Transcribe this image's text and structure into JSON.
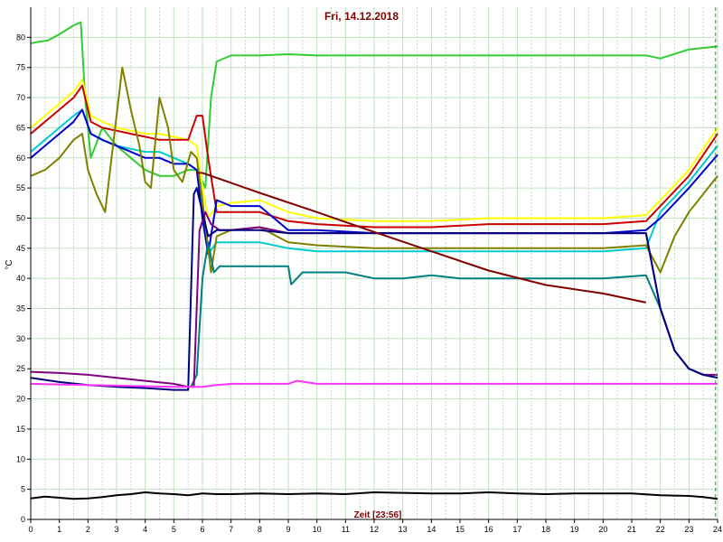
{
  "chart_data": {
    "type": "line",
    "title": "Fri, 14.12.2018",
    "xlabel": "Zeit [23:56]",
    "ylabel": "°C",
    "xlim": [
      0,
      24
    ],
    "ylim": [
      0,
      85
    ],
    "xticks": [
      0,
      1,
      2,
      3,
      4,
      5,
      6,
      7,
      8,
      9,
      10,
      11,
      12,
      13,
      14,
      15,
      16,
      17,
      18,
      19,
      20,
      21,
      22,
      23,
      24
    ],
    "yticks": [
      0,
      5,
      10,
      15,
      20,
      25,
      30,
      35,
      40,
      45,
      50,
      55,
      60,
      65,
      70,
      75,
      80
    ],
    "grid": true,
    "legend": "none",
    "background": "#ffffff",
    "grid_color": "#c0e0c0",
    "current_time_marker": 23.93,
    "series": [
      {
        "color": "#33cc33",
        "x": [
          0,
          0.2,
          0.6,
          1.0,
          1.5,
          1.75,
          1.9,
          2.1,
          2.5,
          3.0,
          3.5,
          4.0,
          4.5,
          5.0,
          5.5,
          5.8,
          6.1,
          6.3,
          6.5,
          7,
          8,
          9,
          10,
          12,
          14,
          16,
          18,
          20,
          21.5,
          22,
          23,
          24
        ],
        "y": [
          79,
          79.2,
          79.5,
          80.5,
          82,
          82.5,
          70,
          60,
          65,
          62,
          60,
          58,
          57,
          57,
          58,
          58,
          55,
          70,
          76,
          77,
          77,
          77.2,
          77,
          77,
          77,
          77,
          77,
          77,
          77,
          76.5,
          78,
          78.5
        ]
      },
      {
        "color": "#ffff00",
        "x": [
          0,
          0.5,
          1.0,
          1.5,
          1.8,
          2.1,
          2.5,
          3.0,
          3.5,
          4.0,
          4.5,
          5.0,
          5.5,
          5.8,
          6.0,
          6.2,
          6.5,
          7,
          8,
          9,
          10,
          12,
          14,
          16,
          18,
          20,
          21.5,
          22,
          23,
          24
        ],
        "y": [
          65,
          67,
          69,
          71,
          73,
          67,
          66,
          65,
          64.5,
          64,
          64,
          63.5,
          63,
          62,
          55,
          50,
          52,
          52.5,
          53,
          51,
          50,
          49.5,
          49.5,
          50,
          50,
          50,
          50.5,
          53,
          58,
          65
        ]
      },
      {
        "color": "#cc0000",
        "x": [
          0,
          0.5,
          1.0,
          1.5,
          1.8,
          2.1,
          2.5,
          3.0,
          3.5,
          4.0,
          4.5,
          5.0,
          5.5,
          5.8,
          6.0,
          6.2,
          6.5,
          7,
          8,
          9,
          10,
          12,
          14,
          16,
          18,
          20,
          21.5,
          22,
          23,
          24
        ],
        "y": [
          64,
          66,
          68,
          70,
          72,
          66,
          65,
          64.5,
          64,
          63.5,
          63,
          63,
          63,
          67,
          67,
          60,
          51,
          51,
          51,
          49.5,
          49,
          48.5,
          48.5,
          49,
          49,
          49,
          49.5,
          52,
          57,
          64
        ]
      },
      {
        "color": "#00cccc",
        "x": [
          0,
          0.5,
          1.0,
          1.5,
          1.8,
          2.1,
          2.5,
          3.0,
          3.5,
          4.0,
          4.5,
          5.0,
          5.5,
          5.8,
          6.0,
          6.2,
          6.5,
          7,
          8,
          9,
          10,
          12,
          14,
          16,
          18,
          20,
          21.5,
          22,
          23,
          24
        ],
        "y": [
          61,
          63,
          65,
          67,
          68,
          64,
          63,
          62,
          61.5,
          61,
          61,
          60,
          59,
          58,
          52,
          44,
          46,
          46,
          46,
          45,
          44.5,
          44.5,
          44.5,
          44.5,
          44.5,
          44.5,
          45,
          51,
          56,
          62
        ]
      },
      {
        "color": "#0000cc",
        "x": [
          0,
          0.5,
          1.0,
          1.5,
          1.8,
          2.1,
          2.5,
          3.0,
          3.5,
          4.0,
          4.5,
          5.0,
          5.5,
          5.8,
          6.0,
          6.2,
          6.5,
          7,
          8,
          9,
          10,
          12,
          14,
          16,
          18,
          20,
          21.5,
          22,
          23,
          24
        ],
        "y": [
          60,
          62,
          64,
          66,
          68,
          64,
          63,
          62,
          61,
          60,
          60,
          59,
          59,
          58,
          50,
          44,
          53,
          52,
          52,
          48,
          48,
          47.5,
          47.5,
          47.5,
          47.5,
          47.5,
          48,
          50,
          55,
          60.5
        ]
      },
      {
        "color": "#808000",
        "x": [
          0,
          0.5,
          1.0,
          1.5,
          1.8,
          2.0,
          2.3,
          2.6,
          2.9,
          3.2,
          3.5,
          3.8,
          4.0,
          4.2,
          4.5,
          4.8,
          5.0,
          5.3,
          5.6,
          5.8,
          6.0,
          6.3,
          6.5,
          7,
          8,
          9,
          10,
          12,
          14,
          16,
          18,
          20,
          21.5,
          22,
          22.5,
          23,
          24
        ],
        "y": [
          57,
          58,
          60,
          63,
          64,
          58,
          54,
          51,
          63,
          75,
          68,
          62,
          56,
          55,
          70,
          65,
          58,
          56,
          61,
          60,
          53,
          41,
          47,
          48,
          48.5,
          46,
          45.5,
          45,
          45,
          45,
          45,
          45,
          45.5,
          41,
          47,
          51,
          57
        ]
      },
      {
        "color": "#008080",
        "x": [
          5.6,
          5.8,
          6.0,
          6.2,
          6.4,
          6.6,
          7,
          8,
          9,
          9.1,
          9.5,
          10,
          11,
          12,
          13,
          14,
          15,
          16,
          17,
          18,
          19,
          20,
          21.5,
          22,
          22.5,
          23,
          23.5,
          24
        ],
        "y": [
          22,
          24,
          40,
          46,
          41,
          42,
          42,
          42,
          42,
          39,
          41,
          41,
          41,
          40,
          40,
          40.5,
          40,
          40,
          40,
          40,
          40,
          40,
          40.5,
          35,
          28,
          25,
          24,
          23.5
        ]
      },
      {
        "color": "#800080",
        "x": [
          0,
          1,
          2,
          3,
          4,
          5,
          5.5,
          5.7,
          5.9,
          6.1,
          6.3,
          6.6,
          7,
          8,
          9,
          10,
          12,
          14,
          16,
          18,
          20,
          21.5,
          22,
          22.5,
          23,
          23.5,
          24
        ],
        "y": [
          24.5,
          24.3,
          24,
          23.5,
          23,
          22.5,
          22,
          22,
          48,
          51,
          49,
          48,
          48,
          48.5,
          47.5,
          47.5,
          47.5,
          47.5,
          47.5,
          47.5,
          47.5,
          47.5,
          35,
          28,
          25,
          24,
          24
        ]
      },
      {
        "color": "#000080",
        "x": [
          0,
          1,
          2,
          3,
          4,
          5,
          5.5,
          5.7,
          5.8,
          6.0,
          6.2,
          6.5,
          7,
          8,
          9,
          10,
          12,
          14,
          16,
          18,
          20,
          21.5,
          22,
          22.5,
          23,
          23.5,
          24
        ],
        "y": [
          23.5,
          22.8,
          22.3,
          22,
          21.8,
          21.5,
          21.5,
          54,
          55,
          51,
          47,
          48,
          48,
          48,
          47.5,
          47.5,
          47.5,
          47.5,
          47.5,
          47.5,
          47.5,
          47.5,
          35,
          28,
          25,
          24,
          23.5
        ]
      },
      {
        "color": "#800000",
        "x": [
          5.8,
          6.0,
          8,
          10,
          12,
          14,
          16,
          18,
          20,
          21.5
        ],
        "y": [
          57.5,
          57.5,
          54.2,
          51,
          47.7,
          44.5,
          41.3,
          38.9,
          37.5,
          36
        ]
      },
      {
        "color": "#ff33ff",
        "x": [
          0,
          1,
          2,
          3,
          4,
          5,
          5.5,
          6,
          6.5,
          7,
          8,
          9,
          9.3,
          10,
          12,
          14,
          16,
          18,
          20,
          22,
          24
        ],
        "y": [
          22.5,
          22.4,
          22.3,
          22.2,
          22.1,
          22,
          22,
          22,
          22.3,
          22.5,
          22.5,
          22.5,
          23,
          22.5,
          22.5,
          22.5,
          22.5,
          22.5,
          22.5,
          22.5,
          22.5
        ]
      },
      {
        "color": "#000000",
        "x": [
          0,
          0.5,
          1,
          1.5,
          2,
          2.5,
          3,
          3.5,
          4,
          4.5,
          5,
          5.5,
          6,
          6.5,
          7,
          8,
          9,
          10,
          11,
          12,
          13,
          14,
          15,
          16,
          17,
          18,
          19,
          20,
          21,
          22,
          23,
          23.5,
          24
        ],
        "y": [
          3.5,
          3.8,
          3.6,
          3.4,
          3.5,
          3.7,
          4.0,
          4.2,
          4.5,
          4.3,
          4.2,
          4.0,
          4.3,
          4.2,
          4.2,
          4.3,
          4.2,
          4.3,
          4.2,
          4.5,
          4.4,
          4.3,
          4.3,
          4.5,
          4.3,
          4.2,
          4.3,
          4.3,
          4.3,
          4.0,
          3.9,
          3.7,
          3.4
        ]
      }
    ]
  }
}
